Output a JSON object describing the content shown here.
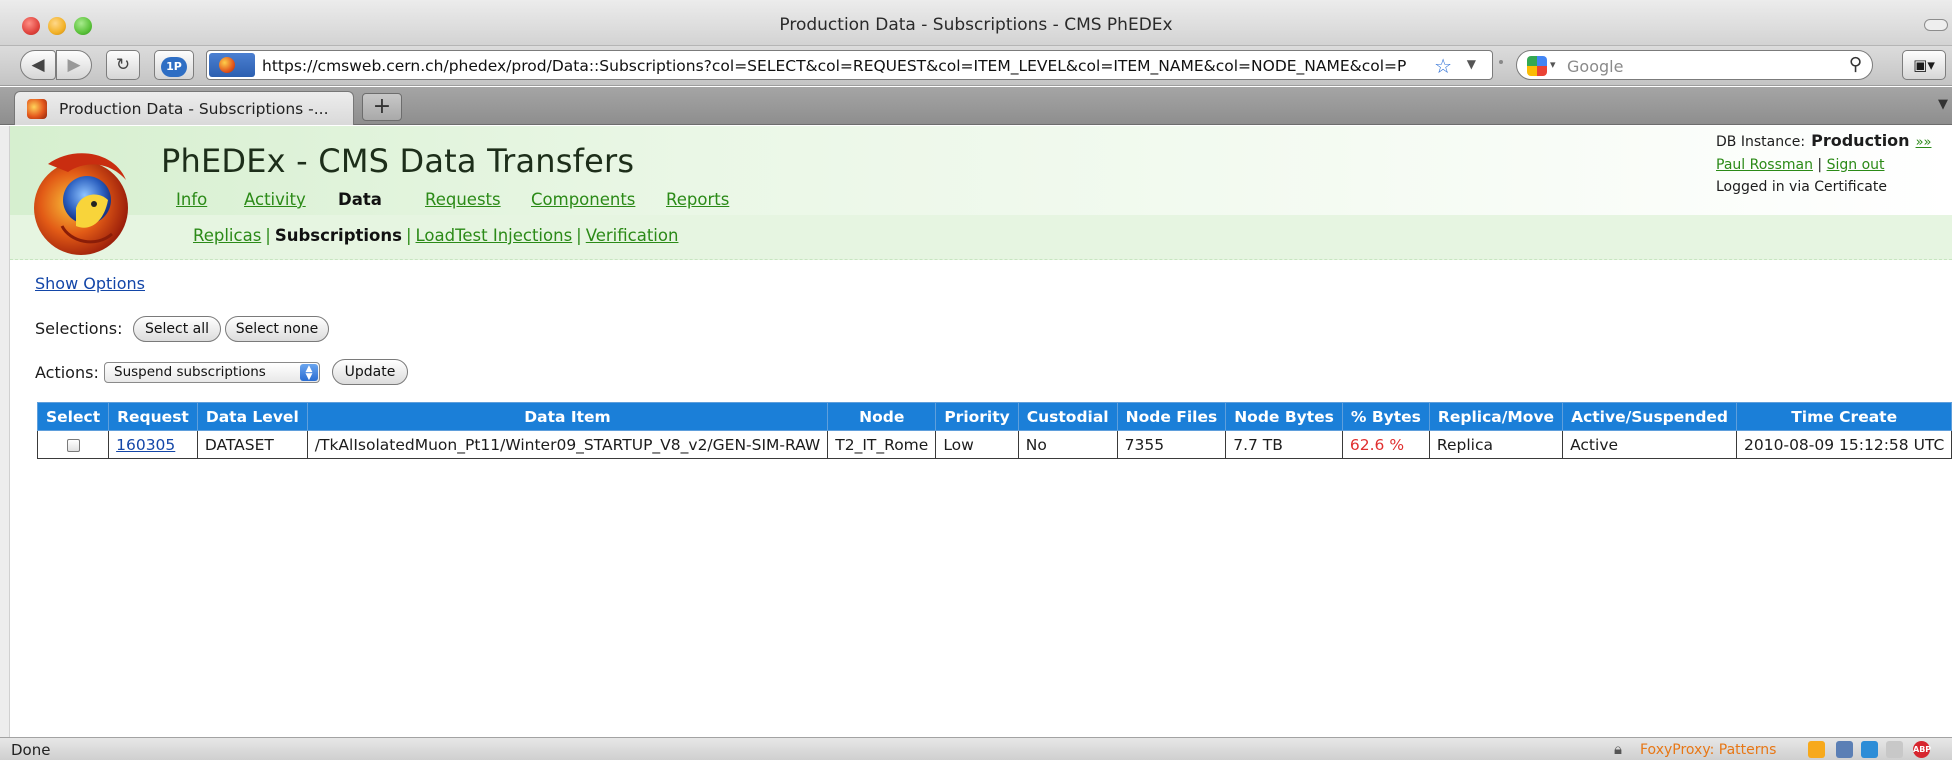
{
  "window": {
    "title": "Production Data - Subscriptions - CMS PhEDEx"
  },
  "toolbar": {
    "url": "https://cmsweb.cern.ch/phedex/prod/Data::Subscriptions?col=SELECT&col=REQUEST&col=ITEM_LEVEL&col=ITEM_NAME&col=NODE_NAME&col=P",
    "search_placeholder": "Google",
    "onep_label": "1P"
  },
  "tabs": [
    {
      "label": "Production Data - Subscriptions -..."
    }
  ],
  "banner": {
    "title": "PhEDEx - CMS Data Transfers",
    "nav": [
      "Info",
      "Activity",
      "Data",
      "Requests",
      "Components",
      "Reports"
    ],
    "active_nav": "Data",
    "subnav": [
      "Replicas",
      "Subscriptions",
      "LoadTest Injections",
      "Verification"
    ],
    "active_subnav": "Subscriptions"
  },
  "session": {
    "db_label": "DB Instance:",
    "db_value": "Production",
    "db_more": "»»",
    "user": "Paul Rossman",
    "sep": "|",
    "sign_out": "Sign out",
    "login_note": "Logged in via Certificate"
  },
  "controls": {
    "show_options": "Show Options",
    "selections_label": "Selections:",
    "select_all": "Select all",
    "select_none": "Select none",
    "actions_label": "Actions:",
    "action_selected": "Suspend subscriptions",
    "update": "Update"
  },
  "table": {
    "headers": [
      "Select",
      "Request",
      "Data Level",
      "Data Item",
      "Node",
      "Priority",
      "Custodial",
      "Node Files",
      "Node Bytes",
      "% Bytes",
      "Replica/Move",
      "Active/Suspended",
      "Time Create"
    ],
    "rows": [
      {
        "request": "160305",
        "data_level": "DATASET",
        "data_item": "/TkAlIsolatedMuon_Pt11/Winter09_STARTUP_V8_v2/GEN-SIM-RAW",
        "node": "T2_IT_Rome",
        "priority": "Low",
        "custodial": "No",
        "node_files": "7355",
        "node_bytes": "7.7 TB",
        "pct_bytes": "62.6 %",
        "replica_move": "Replica",
        "active_suspended": "Active",
        "time_create": "2010-08-09 15:12:58 UTC"
      }
    ],
    "pct_color": "#e02f2f"
  },
  "status": {
    "text": "Done",
    "foxyproxy": "FoxyProxy: Patterns",
    "abp": "ABP"
  },
  "colors": {
    "accent_green": "#2b8a17",
    "table_header": "#1b7fd8",
    "link_blue": "#1346a8"
  }
}
